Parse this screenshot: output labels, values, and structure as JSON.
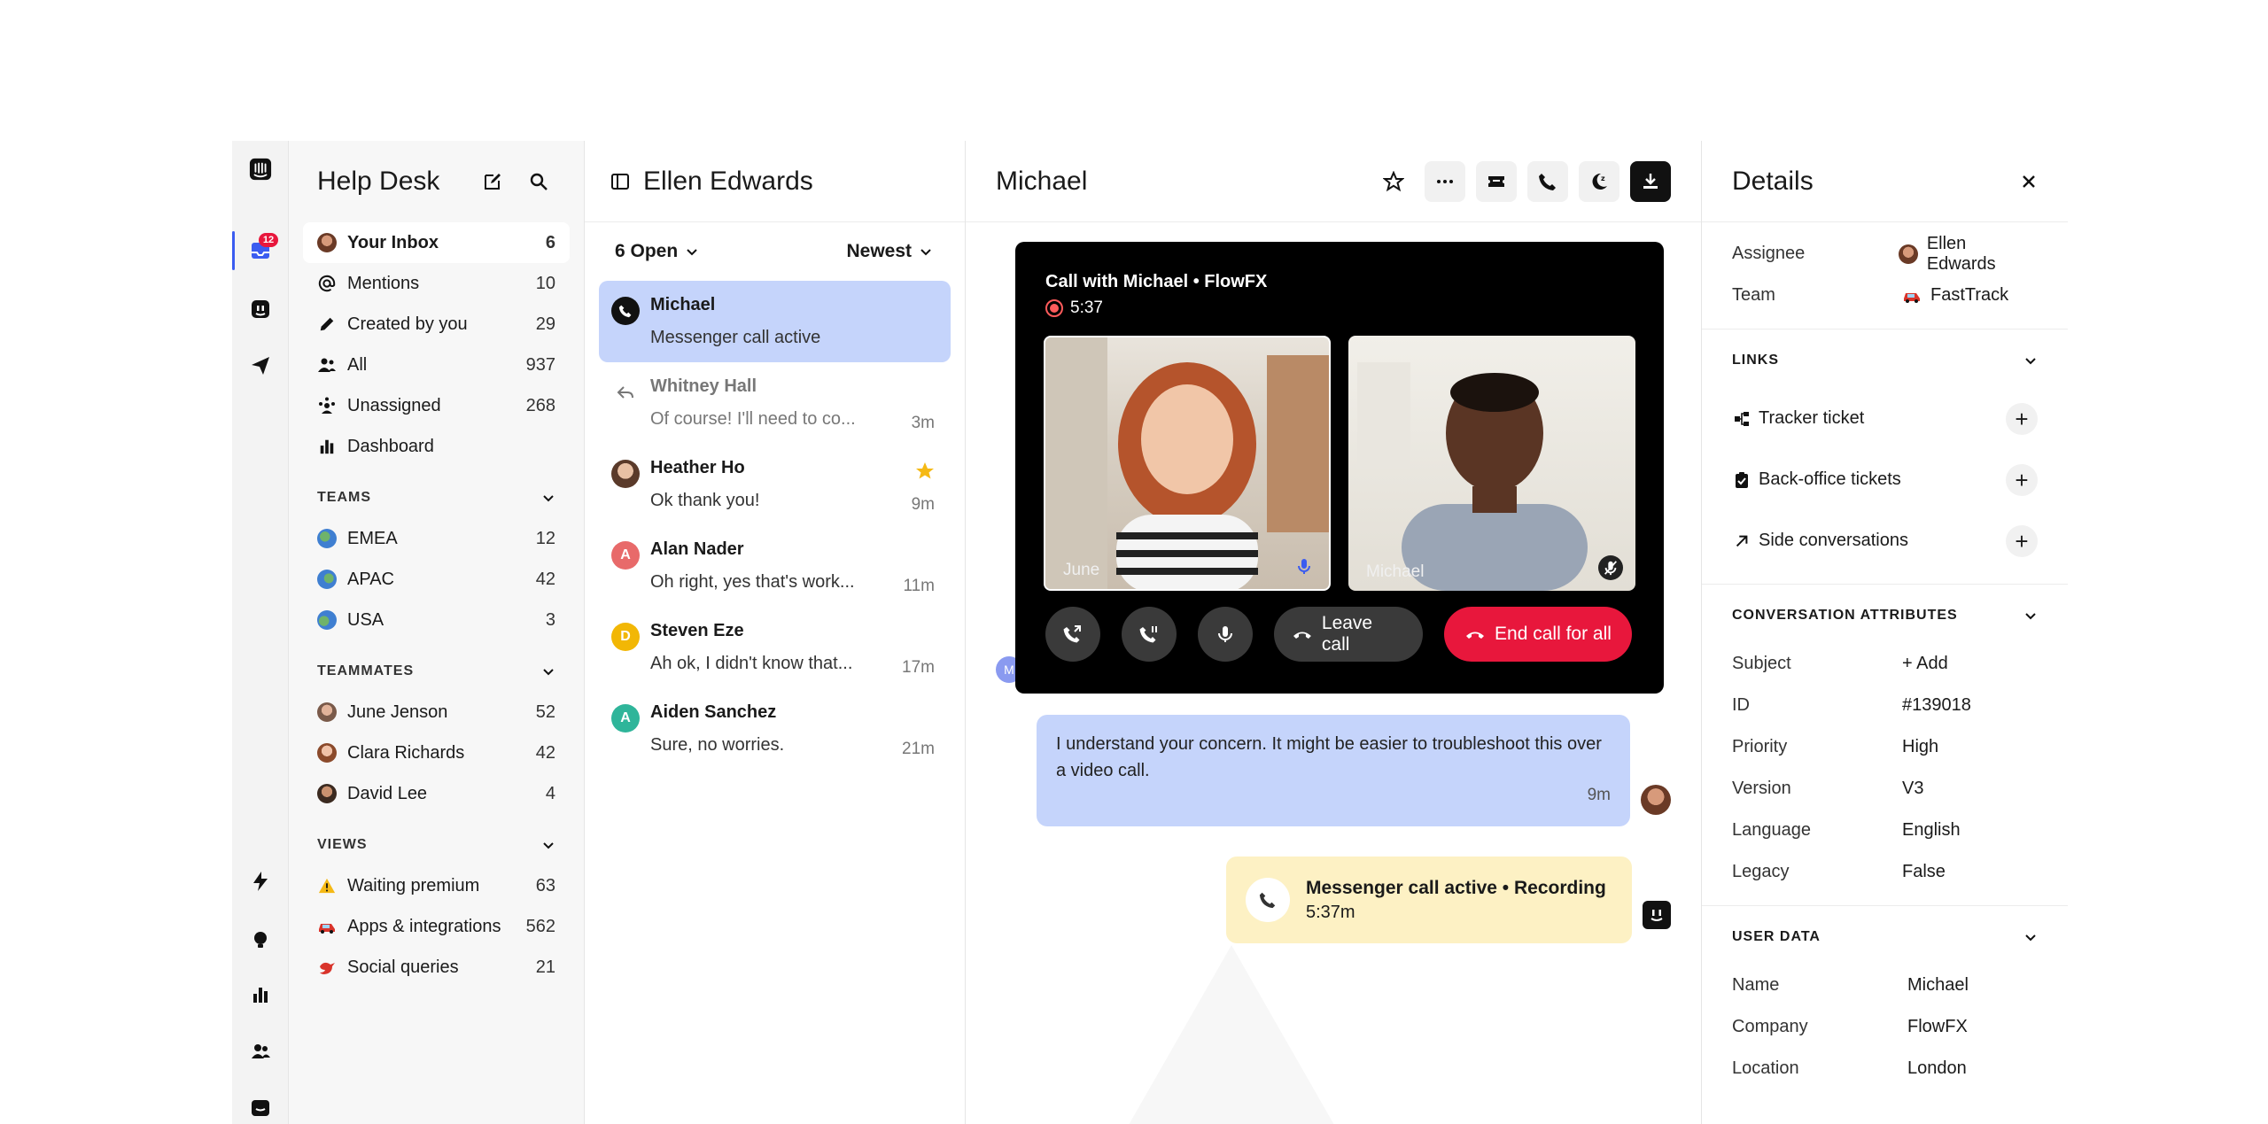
{
  "rail": {
    "inbox_badge": "12"
  },
  "nav": {
    "title": "Help Desk",
    "items": [
      {
        "label": "Your Inbox",
        "count": "6"
      },
      {
        "label": "Mentions",
        "count": "10"
      },
      {
        "label": "Created by you",
        "count": "29"
      },
      {
        "label": "All",
        "count": "937"
      },
      {
        "label": "Unassigned",
        "count": "268"
      },
      {
        "label": "Dashboard",
        "count": ""
      }
    ],
    "teams_heading": "TEAMS",
    "teams": [
      {
        "label": "EMEA",
        "count": "12"
      },
      {
        "label": "APAC",
        "count": "42"
      },
      {
        "label": "USA",
        "count": "3"
      }
    ],
    "teammates_heading": "TEAMMATES",
    "teammates": [
      {
        "label": "June Jenson",
        "count": "52"
      },
      {
        "label": "Clara Richards",
        "count": "42"
      },
      {
        "label": "David Lee",
        "count": "4"
      }
    ],
    "views_heading": "VIEWS",
    "views": [
      {
        "label": "Waiting premium",
        "count": "63"
      },
      {
        "label": "Apps & integrations",
        "count": "562"
      },
      {
        "label": "Social queries",
        "count": "21"
      }
    ]
  },
  "list": {
    "title": "Ellen Edwards",
    "filter_open": "6 Open",
    "sort": "Newest",
    "conversations": [
      {
        "name": "Michael",
        "preview": "Messenger call active",
        "time": ""
      },
      {
        "name": "Whitney Hall",
        "preview": "Of course! I'll need to co...",
        "time": "3m"
      },
      {
        "name": "Heather Ho",
        "preview": "Ok thank you!",
        "time": "9m"
      },
      {
        "name": "Alan Nader",
        "initial": "A",
        "preview": "Oh right, yes that's work...",
        "time": "11m"
      },
      {
        "name": "Steven Eze",
        "initial": "D",
        "preview": "Ah ok, I didn't know that...",
        "time": "17m"
      },
      {
        "name": "Aiden Sanchez",
        "initial": "A",
        "preview": "Sure, no worries.",
        "time": "21m"
      }
    ]
  },
  "chat": {
    "title": "Michael",
    "side_initial": "M",
    "call": {
      "title": "Call with Michael • FlowFX",
      "timer": "5:37",
      "left_name": "June",
      "right_name": "Michael",
      "leave_label": "Leave call",
      "end_label": "End call for all"
    },
    "message": {
      "text": "I understand your concern. It might be easier to troubleshoot this over a video call.",
      "time": "9m"
    },
    "system": {
      "title": "Messenger call active • Recording",
      "duration": "5:37m"
    }
  },
  "details": {
    "title": "Details",
    "assignee_label": "Assignee",
    "assignee": "Ellen Edwards",
    "team_label": "Team",
    "team": "FastTrack",
    "links_heading": "LINKS",
    "links": [
      "Tracker ticket",
      "Back-office tickets",
      "Side conversations"
    ],
    "attrs_heading": "CONVERSATION ATTRIBUTES",
    "attrs": [
      {
        "k": "Subject",
        "v": "+ Add"
      },
      {
        "k": "ID",
        "v": "#139018"
      },
      {
        "k": "Priority",
        "v": "High"
      },
      {
        "k": "Version",
        "v": "V3"
      },
      {
        "k": "Language",
        "v": "English"
      },
      {
        "k": "Legacy",
        "v": "False"
      }
    ],
    "user_heading": "USER DATA",
    "user": [
      {
        "k": "Name",
        "v": "Michael"
      },
      {
        "k": "Company",
        "v": "FlowFX"
      },
      {
        "k": "Location",
        "v": "London"
      }
    ]
  },
  "colors": {
    "accent": "#3b5cf0",
    "selected": "#c5d4fb",
    "danger": "#e8173c",
    "system": "#fdf1c4"
  }
}
